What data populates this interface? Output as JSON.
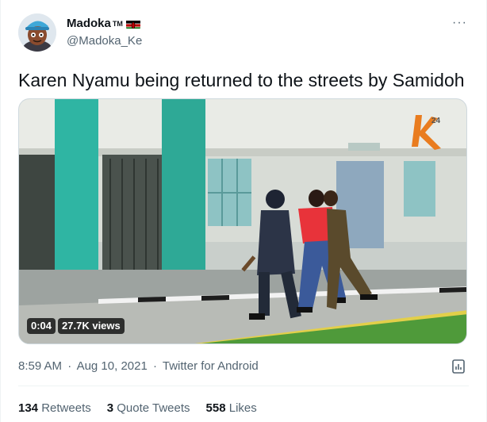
{
  "author": {
    "display_name": "Madoka",
    "tm": "TM",
    "handle": "@Madoka_Ke",
    "avatar_icon": "cartoon-avatar-icon",
    "flag_icon": "kenya-flag-icon"
  },
  "more_icon": "more-options-icon",
  "tweet": {
    "text": "Karen Nyamu being returned to the streets by Samidoh"
  },
  "video": {
    "duration": "0:04",
    "views": "27.7K views",
    "watermark": "K24"
  },
  "meta": {
    "time": "8:59 AM",
    "separator": "·",
    "date": "Aug 10, 2021",
    "source": "Twitter for Android",
    "analytics_icon": "analytics-icon"
  },
  "stats": {
    "retweets_count": "134",
    "retweets_label": "Retweets",
    "quotes_count": "3",
    "quotes_label": "Quote Tweets",
    "likes_count": "558",
    "likes_label": "Likes"
  },
  "colors": {
    "teal_pillar": "#2fb5a3",
    "jacket_red": "#e8333a",
    "text_secondary": "#536471"
  }
}
